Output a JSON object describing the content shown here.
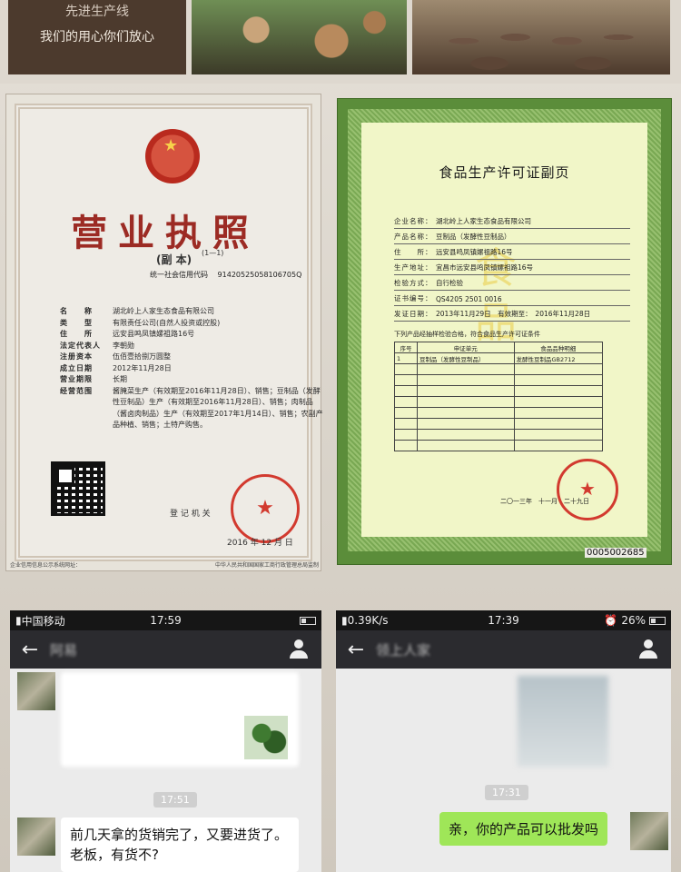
{
  "banner": {
    "line1": "先进生产线",
    "line2": "我们的用心你们放心"
  },
  "license": {
    "title": "营业执照",
    "subtitle": "(副 本)",
    "sub_index": "(1—1)",
    "credit_label": "统一社会信用代码",
    "credit_value": "91420525058106705Q",
    "fields": [
      {
        "k": "名　　称",
        "v": "湖北岭上人家生态食品有限公司"
      },
      {
        "k": "类　　型",
        "v": "有限责任公司(自然人投资或控股)"
      },
      {
        "k": "住　　所",
        "v": "远安县鸣凤镇嫘祖路16号"
      },
      {
        "k": "法定代表人",
        "v": "李朝勋"
      },
      {
        "k": "注册资本",
        "v": "伍佰壹拾捌万圆整"
      },
      {
        "k": "成立日期",
        "v": "2012年11月28日"
      },
      {
        "k": "营业期限",
        "v": "长期"
      },
      {
        "k": "经营范围",
        "v": "酱腌菜生产（有效期至2016年11月28日）、销售；豆制品（发酵性豆制品）生产（有效期至2016年11月28日）、销售；肉制品（酱卤肉制品）生产（有效期至2017年1月14日）、销售；农副产品种植、销售；土特产购售。"
      }
    ],
    "reg_label": "登 记 机 关",
    "date": "2016 年  12 月  日",
    "footer_left": "企业信用信息公示系统网址：",
    "footer_right": "中华人民共和国国家工商行政管理总局监制"
  },
  "permit": {
    "title": "食品生产许可证副页",
    "fields": [
      {
        "k": "企业名称：",
        "v": "湖北岭上人家生态食品有限公司"
      },
      {
        "k": "产品名称：",
        "v": "豆制品（发酵性豆制品）"
      },
      {
        "k": "住　　所：",
        "v": "远安县鸣凤镇嫘祖路16号"
      },
      {
        "k": "生产地址：",
        "v": "宜昌市远安县鸣凤镇嫘祖路16号"
      },
      {
        "k": "检验方式：",
        "v": "自行检验"
      },
      {
        "k": "证书编号：",
        "v": "QS4205 2501 0016"
      },
      {
        "k": "发证日期：",
        "v": "2013年11月29日　有效期至：　2016年11月28日"
      }
    ],
    "watermark": "食品",
    "condition": "下列产品经抽样检验合格，符合食品生产许可证条件",
    "table_headers": [
      "序号",
      "申证单元",
      "食品品种明细"
    ],
    "table_row": [
      "1",
      "豆制品（发酵性豆制品）",
      "发酵性豆制品GB2712"
    ],
    "date": "二〇一三年　十一月　二十九日",
    "serial": "0005002685"
  },
  "phone_left": {
    "carrier": "中国移动",
    "time": "17:59",
    "chat_name": "阿易",
    "chat_time": "17:51",
    "message": "前几天拿的货销完了，又要进货了。老板，有货不?"
  },
  "phone_right": {
    "speed": "0.39K/s",
    "time": "17:39",
    "battery": "26%",
    "chat_name": "领上人家",
    "chat_time": "17:31",
    "message": "亲，你的产品可以批发吗"
  }
}
